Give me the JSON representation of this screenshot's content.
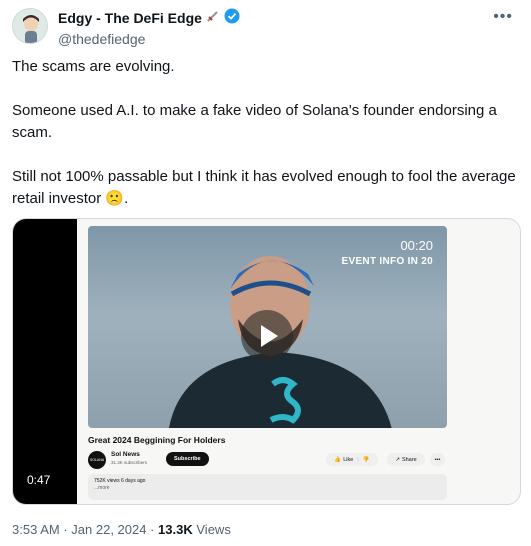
{
  "author": {
    "display_name": "Edgy - The DeFi Edge",
    "handle": "@thedefiedge",
    "verified": true,
    "name_emoji": "dagger-icon"
  },
  "tweet": {
    "paragraphs": [
      "The scams are evolving.",
      "Someone used A.I. to make a fake video of Solana's founder endorsing a scam.",
      "Still not 100% passable but I think it has evolved enough to fool the average retail investor"
    ],
    "trailing_emoji": "🙁",
    "trailing_punct": "."
  },
  "media": {
    "duration": "0:47",
    "video_overlay": {
      "timer": "00:20",
      "event": "EVENT INFO IN 20"
    },
    "video_title": "Great 2024 Beggining For Holders",
    "channel": {
      "avatar_text": "SOLANA",
      "name": "Sol News",
      "subscribers": "31.3K subscribers",
      "subscribe_label": "Subscribe"
    },
    "actions": {
      "like": "Like",
      "share": "Share"
    },
    "description": {
      "stats": "752K views  6 days ago",
      "more": "...more"
    }
  },
  "meta": {
    "time": "3:53 AM",
    "date": "Jan 22, 2024",
    "views_count": "13.3K",
    "views_label": "Views"
  },
  "colors": {
    "verified": "#1d9bf0",
    "secondary_text": "#536471"
  }
}
